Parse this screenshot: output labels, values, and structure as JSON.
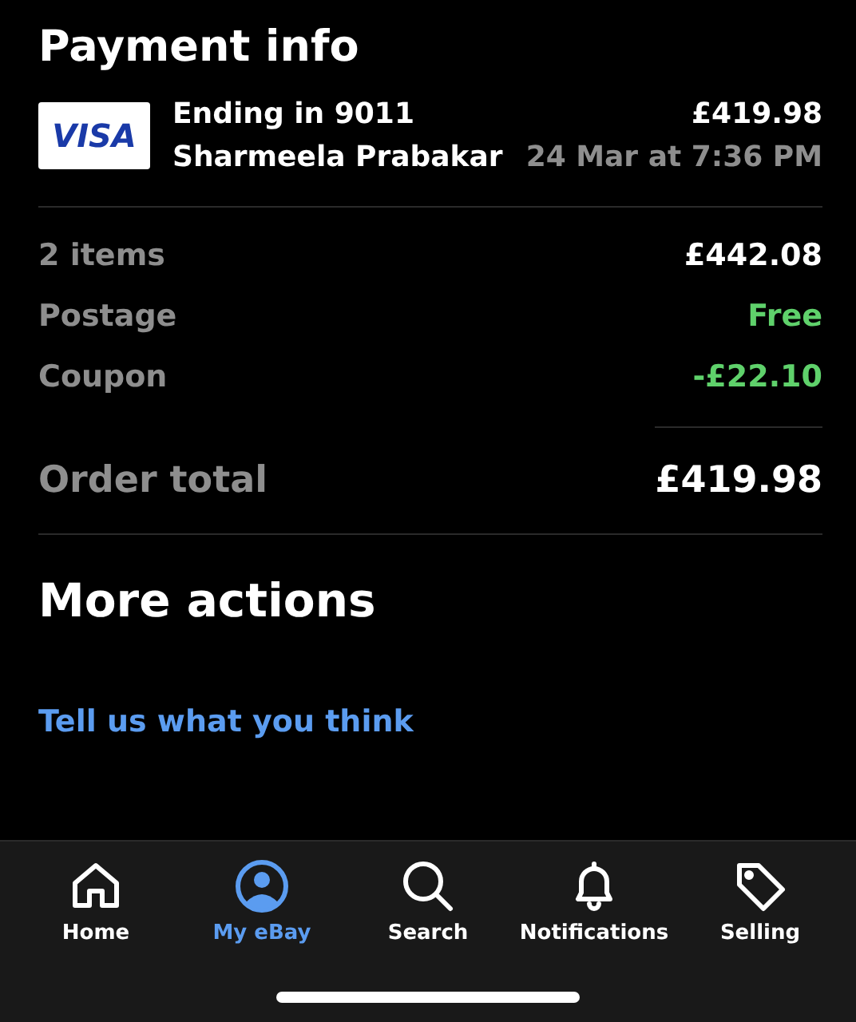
{
  "payment_info": {
    "title": "Payment info",
    "card_logo": "VISA",
    "card_label": "Ending in 9011",
    "cardholder": "Sharmeela Prabakar",
    "amount": "£419.98",
    "date": "24 Mar at 7:36 PM"
  },
  "summary": [
    {
      "label": "2 items",
      "value": "£442.08",
      "highlight": false
    },
    {
      "label": "Postage",
      "value": "Free",
      "highlight": true
    },
    {
      "label": "Coupon",
      "value": "-£22.10",
      "highlight": true
    }
  ],
  "order_total": {
    "label": "Order total",
    "value": "£419.98"
  },
  "more_actions": {
    "title": "More actions",
    "link": "Tell us what you think"
  },
  "tab_bar": [
    {
      "label": "Home",
      "selected": false
    },
    {
      "label": "My eBay",
      "selected": true
    },
    {
      "label": "Search",
      "selected": false
    },
    {
      "label": "Notifications",
      "selected": false
    },
    {
      "label": "Selling",
      "selected": false
    }
  ]
}
